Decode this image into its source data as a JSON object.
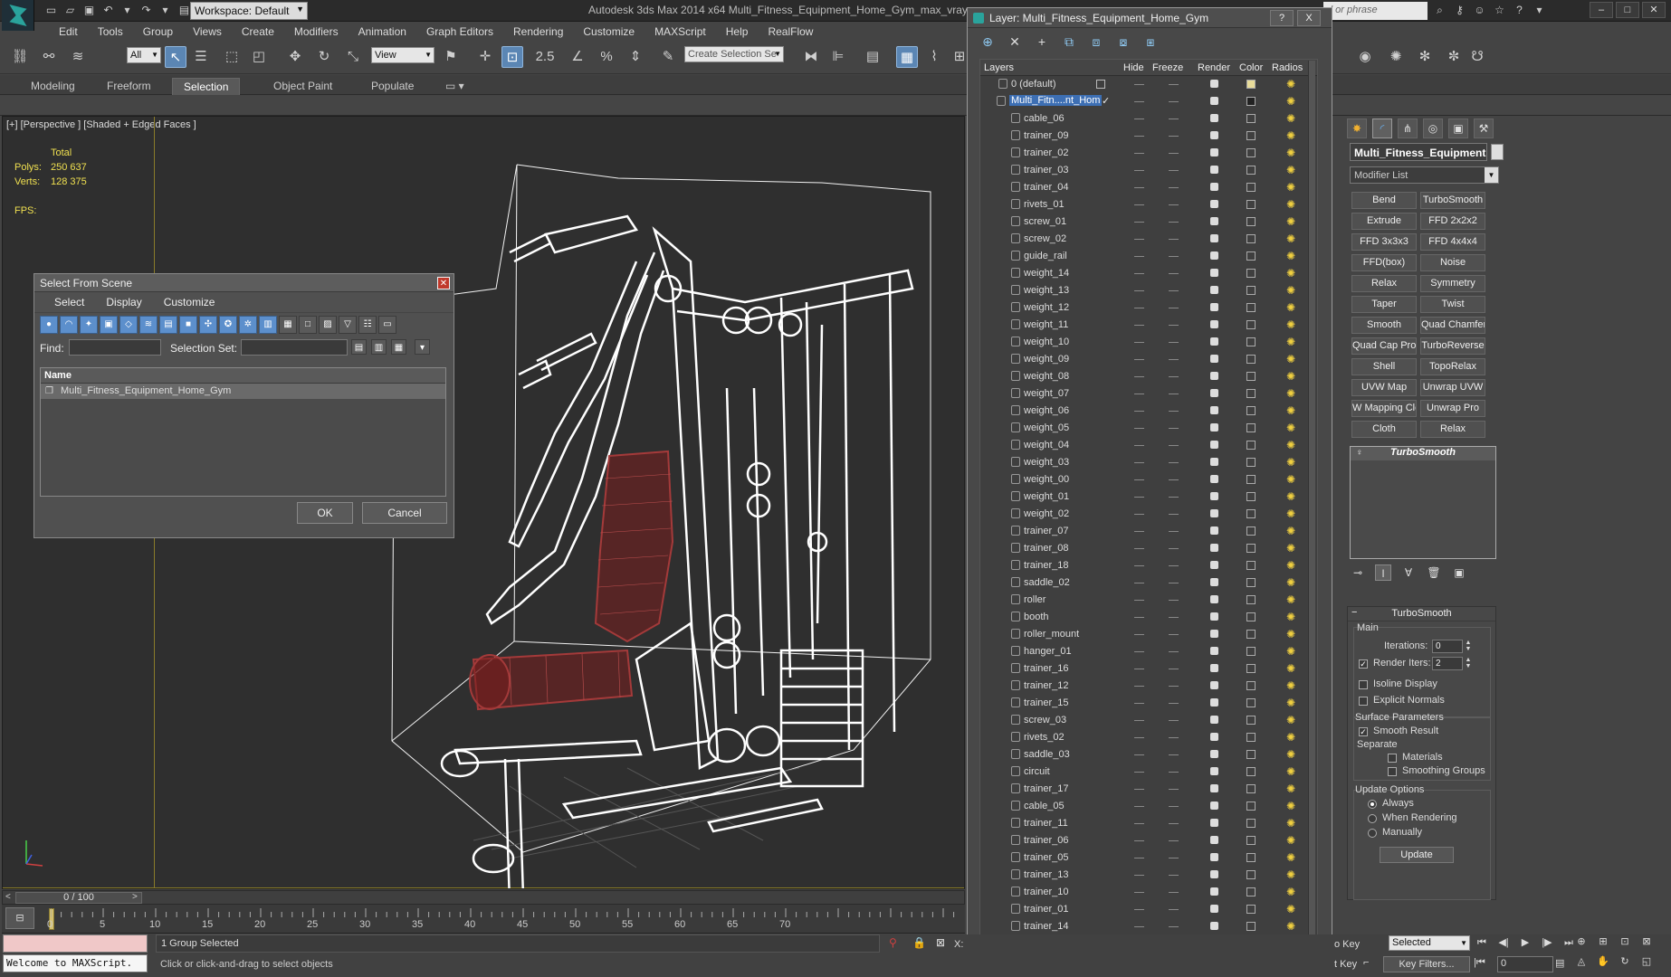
{
  "titlebar": {
    "workspace": "Workspace: Default",
    "title": "Autodesk 3ds Max  2014 x64     Multi_Fitness_Equipment_Home_Gym_max_vray",
    "search_placeholder": "d or phrase"
  },
  "menu": [
    "Edit",
    "Tools",
    "Group",
    "Views",
    "Create",
    "Modifiers",
    "Animation",
    "Graph Editors",
    "Rendering",
    "Customize",
    "MAXScript",
    "Help",
    "RealFlow"
  ],
  "toolbar": {
    "filter": "All",
    "ref_coord": "View",
    "selection_set_placeholder": "Create Selection Se",
    "snap_label": "2.5"
  },
  "ribbon_tabs": [
    "Modeling",
    "Freeform",
    "Selection",
    "Object Paint",
    "Populate"
  ],
  "viewport": {
    "label": "[+] [Perspective ] [Shaded + Edged Faces ]",
    "total_label": "Total",
    "polys_label": "Polys:",
    "polys_value": "250 637",
    "verts_label": "Verts:",
    "verts_value": "128 375",
    "fps_label": "FPS:"
  },
  "select_from_scene": {
    "title": "Select From Scene",
    "menu": [
      "Select",
      "Display",
      "Customize"
    ],
    "find_label": "Find:",
    "selset_label": "Selection Set:",
    "column_name": "Name",
    "items": [
      "Multi_Fitness_Equipment_Home_Gym"
    ],
    "ok": "OK",
    "cancel": "Cancel"
  },
  "layer_manager": {
    "title": "Layer: Multi_Fitness_Equipment_Home_Gym",
    "help_btn": "?",
    "close_btn": "X",
    "columns": {
      "layers": "Layers",
      "hide": "Hide",
      "freeze": "Freeze",
      "render": "Render",
      "color": "Color",
      "radiosity": "Radios"
    },
    "default_layer": "0 (default)",
    "selected_layer": "Multi_Fitn....nt_Hom",
    "objects": [
      "cable_06",
      "trainer_09",
      "trainer_02",
      "trainer_03",
      "trainer_04",
      "rivets_01",
      "screw_01",
      "screw_02",
      "guide_rail",
      "weight_14",
      "weight_13",
      "weight_12",
      "weight_11",
      "weight_10",
      "weight_09",
      "weight_08",
      "weight_07",
      "weight_06",
      "weight_05",
      "weight_04",
      "weight_03",
      "weight_00",
      "weight_01",
      "weight_02",
      "trainer_07",
      "trainer_08",
      "trainer_18",
      "saddle_02",
      "roller",
      "booth",
      "roller_mount",
      "hanger_01",
      "trainer_16",
      "trainer_12",
      "trainer_15",
      "screw_03",
      "rivets_02",
      "saddle_03",
      "circuit",
      "trainer_17",
      "cable_05",
      "trainer_11",
      "trainer_06",
      "trainer_05",
      "trainer_13",
      "trainer_10",
      "trainer_01",
      "trainer_14"
    ]
  },
  "command_panel": {
    "object_name": "Multi_Fitness_Equipment",
    "modifier_list": "Modifier List",
    "modifiers": [
      "Bend",
      "TurboSmooth",
      "Extrude",
      "FFD 2x2x2",
      "FFD 3x3x3",
      "FFD 4x4x4",
      "FFD(box)",
      "Noise",
      "Relax",
      "Symmetry",
      "Taper",
      "Twist",
      "Smooth",
      "Quad Chamfer",
      "Quad Cap Pro",
      "TurboReverse",
      "Shell",
      "TopoRelax",
      "UVW Map",
      "Unwrap UVW",
      "W Mapping Cle",
      "Unwrap Pro",
      "Cloth",
      "Relax"
    ],
    "stack_item": "TurboSmooth",
    "rollout": {
      "title": "TurboSmooth",
      "main": "Main",
      "iterations_label": "Iterations:",
      "iterations_value": "0",
      "render_iters_label": "Render Iters:",
      "render_iters_value": "2",
      "isoline": "Isoline Display",
      "explicit_normals": "Explicit Normals",
      "surface_params": "Surface Parameters",
      "smooth_result": "Smooth Result",
      "separate": "Separate",
      "materials": "Materials",
      "smoothing_groups": "Smoothing Groups",
      "update_options": "Update Options",
      "always": "Always",
      "when_rendering": "When Rendering",
      "manually": "Manually",
      "update": "Update"
    }
  },
  "timeline": {
    "frame_display": "0 / 100",
    "ticks": [
      "0",
      "5",
      "10",
      "15",
      "20",
      "25",
      "30",
      "35",
      "40",
      "45",
      "50",
      "55",
      "60",
      "65",
      "70"
    ]
  },
  "status": {
    "maxscript_output": "Welcome to MAXScript.",
    "selected": "1 Group Selected",
    "prompt": "Click or click-and-drag to select objects",
    "set_key_label": "o Key",
    "selected_dd": "Selected",
    "set_key_label2": "t Key",
    "key_filters": "Key Filters...",
    "frame": "0",
    "x_label": "X:"
  },
  "colors": {
    "accent": "#5b86b4",
    "stats": "#f0e050",
    "selected_layer": "#3d6fb4",
    "wire_red": "#8b2a2a"
  }
}
